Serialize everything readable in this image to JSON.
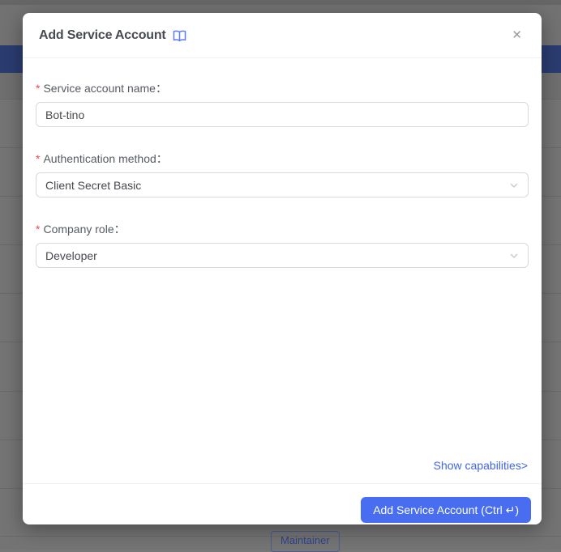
{
  "background": {
    "maintainer_badge_label": "Maintainer"
  },
  "modal": {
    "title": "Add Service Account",
    "close_glyph": "✕",
    "required_mark": "*",
    "fields": [
      {
        "label": "Service account name：",
        "type": "input",
        "value": "Bot-tino"
      },
      {
        "label": "Authentication method：",
        "type": "select",
        "value": "Client Secret Basic"
      },
      {
        "label": "Company role：",
        "type": "select",
        "value": "Developer"
      }
    ],
    "capabilities_link": "Show capabilities>",
    "submit_label": "Add Service Account (Ctrl ↵)"
  },
  "icons": {
    "title_icon": "open-book",
    "select_icon": "chevron-down",
    "close_icon": "x-mark"
  },
  "colors": {
    "accent_blue": "#4a6df0",
    "button_blue": "#486df0",
    "link_blue": "#4264eb",
    "required_red": "#f5474b",
    "nav_bar_blue": "#2b3e73",
    "badge_text_blue": "#2e4590"
  }
}
